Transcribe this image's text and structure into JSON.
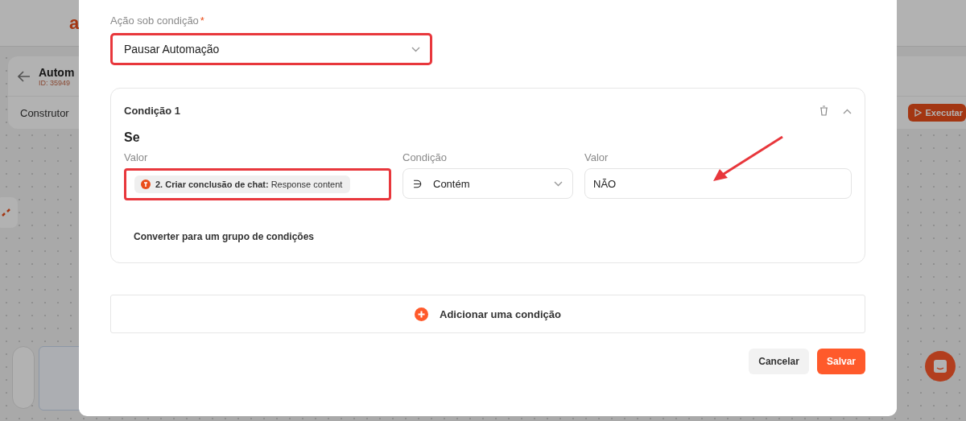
{
  "background": {
    "logo": "a",
    "title": "Autom",
    "id": "ID: 35949",
    "tab": "Construtor",
    "run_button": "Executar"
  },
  "modal": {
    "action_label": "Ação sob condição",
    "required_mark": "*",
    "action_value": "Pausar Automação",
    "action_highlighted": true,
    "conditions": [
      {
        "title": "Condição 1",
        "expanded": true,
        "if_label": "Se",
        "value_label": "Valor",
        "value_chip": {
          "bold": "2. Criar conclusão de chat:",
          "text": "Response content"
        },
        "value_highlighted": true,
        "condition_label": "Condição",
        "condition_symbol": "∋",
        "condition_value": "Contém",
        "second_value_label": "Valor",
        "second_value": "NÃO",
        "arrow": true,
        "convert_link": "Converter para um grupo de condições"
      }
    ],
    "add_condition": "Adicionar uma condição",
    "buttons": [
      {
        "label": "Cancelar",
        "kind": "secondary"
      },
      {
        "label": "Salvar",
        "kind": "primary"
      }
    ]
  }
}
